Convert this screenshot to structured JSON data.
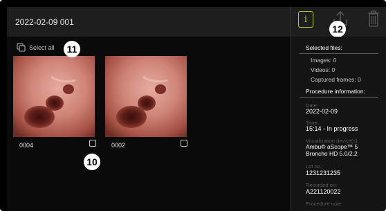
{
  "header": {
    "title": "2022-02-09 001"
  },
  "toolbar": {
    "select_all_label": "Select all",
    "info_label": "i",
    "accent_color": "#b6c730"
  },
  "thumbnails": [
    {
      "label": "0004",
      "checked": false
    },
    {
      "label": "0002",
      "checked": false
    }
  ],
  "callouts": {
    "select_all": "11",
    "checkbox": "10",
    "export": "12"
  },
  "sidebar": {
    "selected_files_heading": "Selected files:",
    "images": "Images: 0",
    "videos": "Videos: 0",
    "captured_frames": "Captured frames: 0",
    "procedure_heading": "Procedure information:",
    "fields": [
      {
        "label": "Date:",
        "value": "2022-02-09"
      },
      {
        "label": "Time:",
        "value": "15:14 - In progress"
      },
      {
        "label": "Visualization device(s):",
        "value_line1": "Ambu® aScope™ 5",
        "value_line2": "Broncho HD 5.0/2.2"
      },
      {
        "label": "Lot no.:",
        "value": "1231231235"
      },
      {
        "label": "Recorded on:",
        "value": "A221120022"
      },
      {
        "label": "Procedure note:"
      }
    ]
  },
  "icons": [
    "multi-select-icon",
    "info-icon",
    "export-icon",
    "trash-icon",
    "checkbox-icon"
  ]
}
